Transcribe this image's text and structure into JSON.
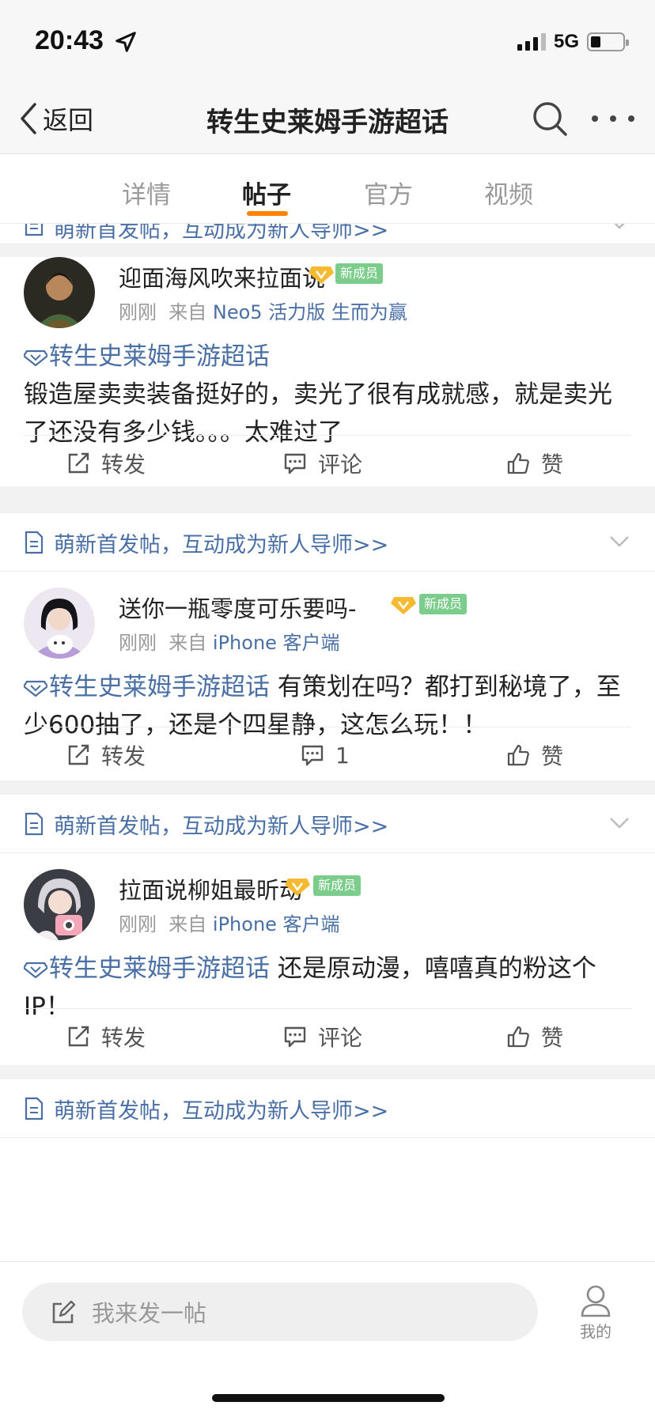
{
  "status": {
    "time": "20:43",
    "network": "5G"
  },
  "nav": {
    "back_label": "返回",
    "title": "转生史莱姆手游超话"
  },
  "tabs": [
    {
      "label": "详情",
      "active": false
    },
    {
      "label": "帖子",
      "active": true
    },
    {
      "label": "官方",
      "active": false
    },
    {
      "label": "视频",
      "active": false
    }
  ],
  "colors": {
    "accent": "#ff8200",
    "link": "#4a6fa5",
    "badge": "#7ccd8c"
  },
  "banner_text": "萌新首发帖，互动成为新人导师>>",
  "posts": [
    {
      "username": "迎面海风吹来拉面说",
      "badge": "新成员",
      "time": "刚刚",
      "from": "来自",
      "source": "Neo5 活力版 生而为赢",
      "topic": "转生史莱姆手游超话",
      "text": "锻造屋卖卖装备挺好的，卖光了很有成就感，就是卖光了还没有多少钱。。。太难过了",
      "repost": "转发",
      "comment": "评论",
      "like": "赞"
    },
    {
      "username": "送你一瓶零度可乐要吗-",
      "badge": "新成员",
      "time": "刚刚",
      "from": "来自",
      "source": "iPhone 客户端",
      "topic": "转生史莱姆手游超话",
      "text": " 有策划在吗？都打到秘境了，至少600抽了，还是个四星静，这怎么玩！！",
      "repost": "转发",
      "comment": "1",
      "like": "赞"
    },
    {
      "username": "拉面说柳姐最昕动",
      "badge": "新成员",
      "time": "刚刚",
      "from": "来自",
      "source": "iPhone 客户端",
      "topic": "转生史莱姆手游超话",
      "text": " 还是原动漫，嘻嘻真的粉这个IP！",
      "repost": "转发",
      "comment": "评论",
      "like": "赞"
    }
  ],
  "bottom": {
    "compose_placeholder": "我来发一帖",
    "me_label": "我的"
  }
}
